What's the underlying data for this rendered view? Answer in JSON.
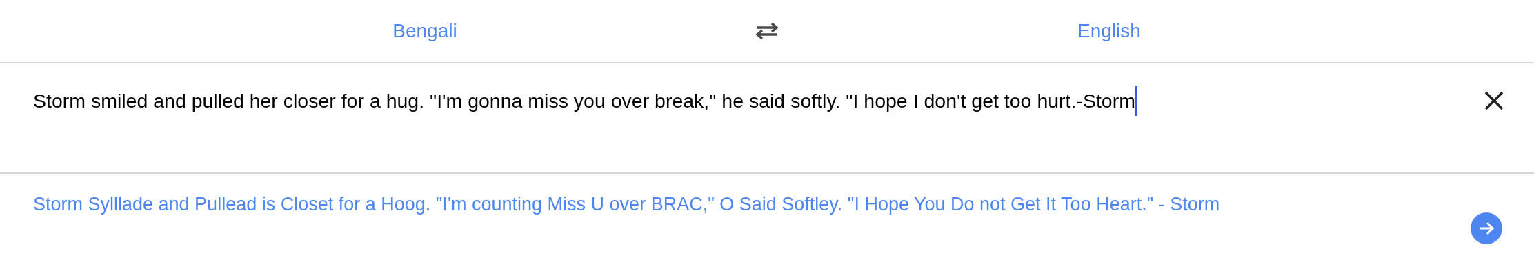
{
  "languages": {
    "source": "Bengali",
    "target": "English"
  },
  "input": {
    "value": "Storm smiled and pulled her closer for a hug. \"I'm gonna miss you over break,\" he said softly. \"I hope I don't get too hurt.-Storm"
  },
  "output": {
    "text": "Storm Sylllade and Pullead is Closet for a Hoog. \"I'm counting Miss U over BRAC,\" O Said Softley. \"I Hope You Do not Get It Too Heart.\" - Storm"
  }
}
